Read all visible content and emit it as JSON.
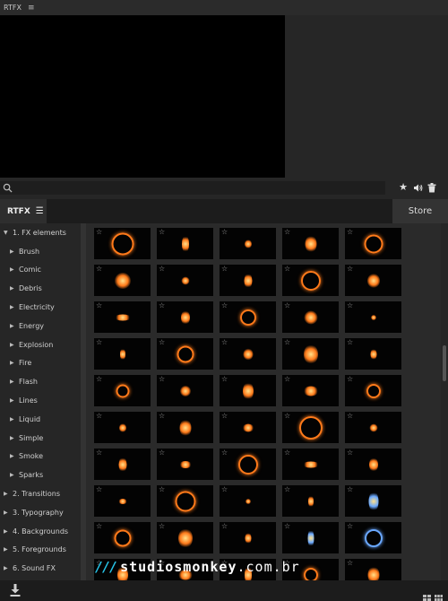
{
  "app": {
    "title": "RTFX"
  },
  "search": {
    "placeholder": ""
  },
  "tab": {
    "label": "RTFX"
  },
  "store": {
    "label": "Store"
  },
  "sidebar": {
    "items": [
      {
        "label": "1. FX elements",
        "level": 0,
        "expanded": true
      },
      {
        "label": "Brush",
        "level": 1
      },
      {
        "label": "Comic",
        "level": 1
      },
      {
        "label": "Debris",
        "level": 1
      },
      {
        "label": "Electricity",
        "level": 1
      },
      {
        "label": "Energy",
        "level": 1
      },
      {
        "label": "Explosion",
        "level": 1
      },
      {
        "label": "Fire",
        "level": 1
      },
      {
        "label": "Flash",
        "level": 1
      },
      {
        "label": "Lines",
        "level": 1
      },
      {
        "label": "Liquid",
        "level": 1
      },
      {
        "label": "Simple",
        "level": 1
      },
      {
        "label": "Smoke",
        "level": 1
      },
      {
        "label": "Sparks",
        "level": 1
      },
      {
        "label": "2. Transitions",
        "level": 0
      },
      {
        "label": "3. Typography",
        "level": 0
      },
      {
        "label": "4. Backgrounds",
        "level": 0
      },
      {
        "label": "5. Foregrounds",
        "level": 0
      },
      {
        "label": "6. Sound FX",
        "level": 0
      }
    ]
  },
  "watermark": {
    "slashes": "///",
    "name": "studiosmonkey",
    "domain": ".com.br"
  },
  "colors": {
    "accent": "#27c3e6",
    "fx_core": "#ffe08a",
    "fx_glow": "#ff7a1a",
    "fx_blue": "#6aa8ff"
  }
}
